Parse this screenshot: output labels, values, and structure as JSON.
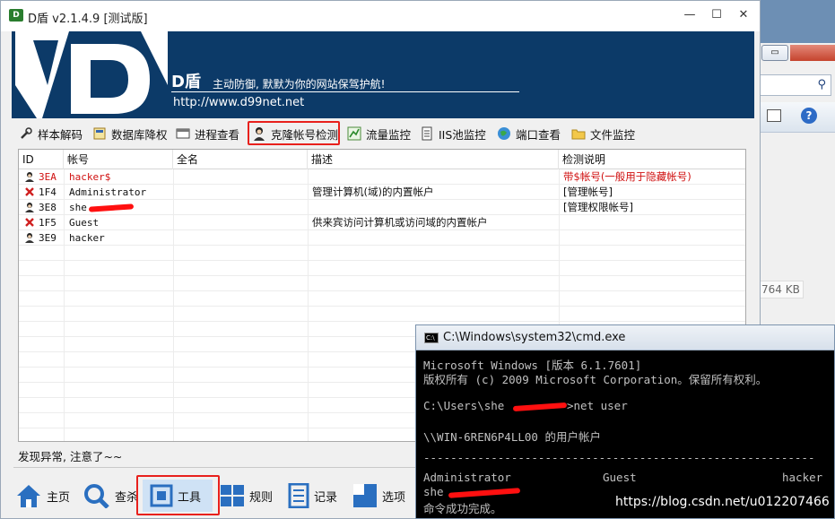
{
  "window": {
    "title": "D盾 v2.1.4.9 [测试版]",
    "icon_label": "D"
  },
  "banner": {
    "brand": "D盾",
    "slogan": "主动防御, 默默为你的网站保驾护航!",
    "url": "http://www.d99net.net"
  },
  "toolbar": [
    {
      "label": "样本解码",
      "icon": "wrench-icon"
    },
    {
      "label": "数据库降权",
      "icon": "database-icon"
    },
    {
      "label": "进程查看",
      "icon": "window-icon"
    },
    {
      "label": "克隆帐号检测",
      "icon": "user-icon",
      "highlighted": true
    },
    {
      "label": "流量监控",
      "icon": "chart-icon"
    },
    {
      "label": "IIS池监控",
      "icon": "pool-icon"
    },
    {
      "label": "端口查看",
      "icon": "globe-icon"
    },
    {
      "label": "文件监控",
      "icon": "folder-icon"
    }
  ],
  "table": {
    "columns": [
      "ID",
      "帐号",
      "全名",
      "描述",
      "检测说明"
    ],
    "rows": [
      {
        "id": "3EA",
        "account": "hacker$",
        "fullname": "",
        "desc": "",
        "note": "带$帐号(一般用于隐藏帐号)",
        "alert": true,
        "status_icon": "user-icon"
      },
      {
        "id": "1F4",
        "account": "Administrator",
        "fullname": "",
        "desc": "管理计算机(域)的内置帐户",
        "note": "[管理帐号]",
        "alert": false,
        "status_icon": "disabled-x-icon"
      },
      {
        "id": "3E8",
        "account": "she",
        "fullname": "",
        "desc": "",
        "note": "[管理权限帐号]",
        "alert": false,
        "status_icon": "user-icon"
      },
      {
        "id": "1F5",
        "account": "Guest",
        "fullname": "",
        "desc": "供来宾访问计算机或访问域的内置帐户",
        "note": "",
        "alert": false,
        "status_icon": "disabled-x-icon"
      },
      {
        "id": "3E9",
        "account": "hacker",
        "fullname": "",
        "desc": "",
        "note": "",
        "alert": false,
        "status_icon": "user-icon"
      }
    ]
  },
  "status": "发现异常, 注意了~~",
  "nav": [
    {
      "label": "主页",
      "icon": "home-icon"
    },
    {
      "label": "查杀",
      "icon": "search-icon"
    },
    {
      "label": "工具",
      "icon": "tools-icon",
      "active": true
    },
    {
      "label": "规则",
      "icon": "rules-icon"
    },
    {
      "label": "记录",
      "icon": "log-icon"
    },
    {
      "label": "选项",
      "icon": "options-icon"
    }
  ],
  "cmd": {
    "title": "C:\\Windows\\system32\\cmd.exe",
    "lines": [
      "Microsoft Windows [版本 6.1.7601]",
      "版权所有 (c) 2009 Microsoft Corporation。保留所有权利。",
      "C:\\Users\\she",
      ">net user",
      "\\\\WIN-6REN6P4LL00 的用户帐户",
      "Administrator",
      "Guest",
      "hacker",
      "she",
      "命令成功完成。"
    ]
  },
  "background_window": {
    "file_size": "764 KB"
  },
  "watermark": "https://blog.csdn.net/u012207466",
  "colors": {
    "banner_bg": "#0c3a68",
    "alert_red": "#d01010",
    "highlight_border": "#e8201c"
  }
}
